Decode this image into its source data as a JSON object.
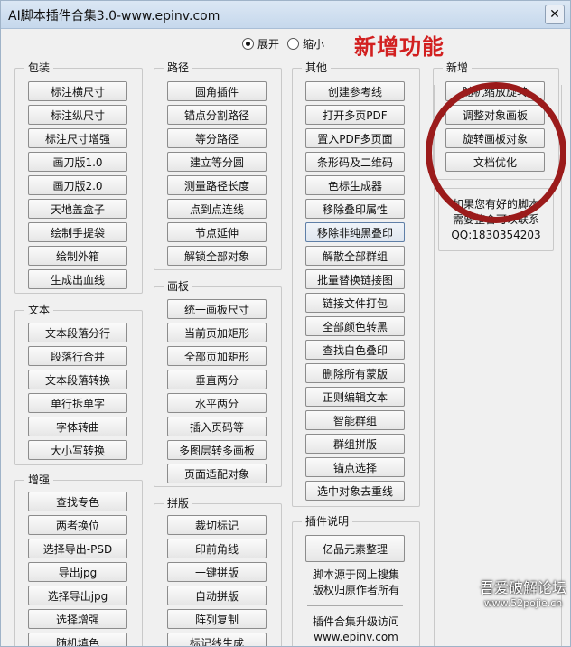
{
  "window": {
    "title": "AI脚本插件合集3.0-www.epinv.com",
    "close_glyph": "✕"
  },
  "view_mode": {
    "options": [
      "展开",
      "缩小"
    ],
    "selected": "展开"
  },
  "banner": "新增功能",
  "groups": {
    "packaging": {
      "title": "包装",
      "buttons": [
        "标注横尺寸",
        "标注纵尺寸",
        "标注尺寸增强",
        "画刀版1.0",
        "画刀版2.0",
        "天地盖盒子",
        "绘制手提袋",
        "绘制外箱",
        "生成出血线"
      ]
    },
    "text": {
      "title": "文本",
      "buttons": [
        "文本段落分行",
        "段落行合并",
        "文本段落转换",
        "单行拆单字",
        "字体转曲",
        "大小写转换"
      ]
    },
    "enhance": {
      "title": "增强",
      "buttons": [
        "查找专色",
        "两者换位",
        "选择导出-PSD",
        "导出jpg",
        "选择导出jpg",
        "选择增强",
        "随机填色"
      ]
    },
    "path": {
      "title": "路径",
      "buttons": [
        "圆角插件",
        "锚点分割路径",
        "等分路径",
        "建立等分圆",
        "测量路径长度",
        "点到点连线",
        "节点延伸",
        "解锁全部对象"
      ]
    },
    "artboard": {
      "title": "画板",
      "buttons": [
        "统一画板尺寸",
        "当前页加矩形",
        "全部页加矩形",
        "垂直两分",
        "水平两分",
        "插入页码等",
        "多图层转多画板",
        "页面适配对象"
      ]
    },
    "imposition": {
      "title": "拼版",
      "buttons": [
        "裁切标记",
        "印前角线",
        "一键拼版",
        "自动拼版",
        "阵列复制",
        "标记线生成"
      ]
    },
    "other": {
      "title": "其他",
      "buttons": [
        "创建参考线",
        "打开多页PDF",
        "置入PDF多页面",
        "条形码及二维码",
        "色标生成器",
        "移除叠印属性",
        "移除非纯黑叠印",
        "解散全部群组",
        "批量替换链接图",
        "链接文件打包",
        "全部颜色转黑",
        "查找白色叠印",
        "删除所有蒙版",
        "正则编辑文本",
        "智能群组",
        "群组拼版",
        "锚点选择",
        "选中对象去重线"
      ]
    },
    "plugin_info": {
      "title": "插件说明",
      "button": "亿品元素整理",
      "line1": "脚本源于网上搜集",
      "line2": "版权归原作者所有",
      "line3": "插件合集升级访问",
      "line4": "www.epinv.com"
    },
    "new": {
      "title": "新增",
      "buttons": [
        "随机缩放旋转",
        "调整对象画板",
        "旋转画板对象",
        "文档优化"
      ]
    },
    "contact": {
      "line1": "如果您有好的脚本",
      "line2": "需要整合可以联系",
      "line3": "QQ:1830354203"
    }
  },
  "watermark": {
    "line1": "吾爱破解论坛",
    "line2": "www.52pojie.cn"
  },
  "colors": {
    "banner": "#d22020",
    "ring": "#9b1b1b"
  }
}
